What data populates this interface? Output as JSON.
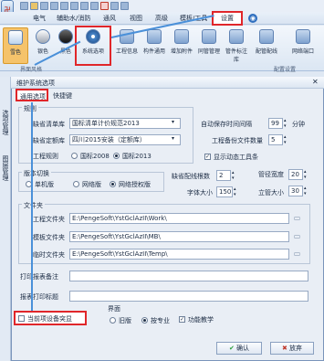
{
  "ribbon": {
    "tabs": [
      "电气",
      "辅助水/消防",
      "通风",
      "视图",
      "高级",
      "模板/工具",
      "设置"
    ],
    "buttons": [
      "雪色",
      "银色",
      "黑色",
      "系统选项",
      "工程信息",
      "构件通用",
      "增加附件",
      "同管管理",
      "管件标注库",
      "配管配线",
      "网络端口"
    ],
    "group_labels": [
      "界面风格",
      "",
      "",
      "配置设置"
    ]
  },
  "dialog": {
    "title": "维护系统选项",
    "tabs": [
      "通用选项",
      "快捷键"
    ],
    "rules": {
      "group_label": "规则",
      "qingdan_label": "缺省清单库",
      "qingdan_value": "国标清单计价规范2013",
      "dinge_label": "缺省定额库",
      "dinge_value": "四川2015安装（定额库）",
      "project_label": "工程规则",
      "project_opts": [
        "国标2008",
        "国标2013"
      ]
    },
    "autosave_label": "自动保存时间间隔",
    "autosave_value": "99",
    "autosave_unit": "分钟",
    "backup_label": "工程备份文件数量",
    "backup_value": "5",
    "show_toolbar": "显示动态工具条",
    "version": {
      "group_label": "版本切换",
      "opts": [
        "单机版",
        "网络版",
        "网络授权版"
      ]
    },
    "default_wire_label": "缺省配线根数",
    "default_wire_value": "2",
    "pipe_width_label": "管径宽度",
    "pipe_width_value": "20",
    "font_size_label": "字体大小",
    "font_size_value": "150",
    "grid_label": "立管大小",
    "grid_value": "30",
    "paths": {
      "group_label": "文件夹",
      "rows": [
        {
          "label": "工程文件夹",
          "value": "E:\\PengeSoft\\YstGclAzII\\Work\\"
        },
        {
          "label": "模板文件夹",
          "value": "E:\\PengeSoft\\YstGclAzII\\MB\\"
        },
        {
          "label": "临时文件夹",
          "value": "E:\\PengeSoft\\YstGclAzII\\Temp\\"
        }
      ]
    },
    "print_note_label": "打印报表备注",
    "print_note_value": "",
    "print_title_label": "报表打印标题",
    "print_title_value": "",
    "highlight_label": "当前项设备突显",
    "interface": {
      "group_label": "界面",
      "opts": [
        "旧版",
        "按专业"
      ]
    },
    "feature_learn": "功能教学",
    "ok": "确认",
    "cancel": "放弃"
  },
  "sidebar": [
    "选项管理",
    "图层管理"
  ]
}
